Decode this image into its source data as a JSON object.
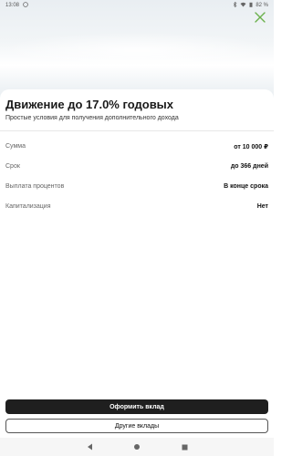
{
  "status_bar": {
    "time": "13:08",
    "battery": "82 %"
  },
  "offer": {
    "title": "Движение до 17.0% годовых",
    "subtitle": "Простые условия для получения дополнительного дохода"
  },
  "details": [
    {
      "label": "Сумма",
      "value": "от 10 000 ₽"
    },
    {
      "label": "Срок",
      "value": "до 366 дней"
    },
    {
      "label": "Выплата процентов",
      "value": "В конце срока"
    },
    {
      "label": "Капитализация",
      "value": "Нет"
    }
  ],
  "buttons": {
    "primary": "Оформить вклад",
    "secondary": "Другие вклады"
  },
  "colors": {
    "accent_close": "#6ab04c",
    "primary_button": "#1f1f1f"
  },
  "icons": {
    "close": "close-icon",
    "back": "back-icon",
    "home": "home-icon",
    "recents": "recents-icon"
  }
}
